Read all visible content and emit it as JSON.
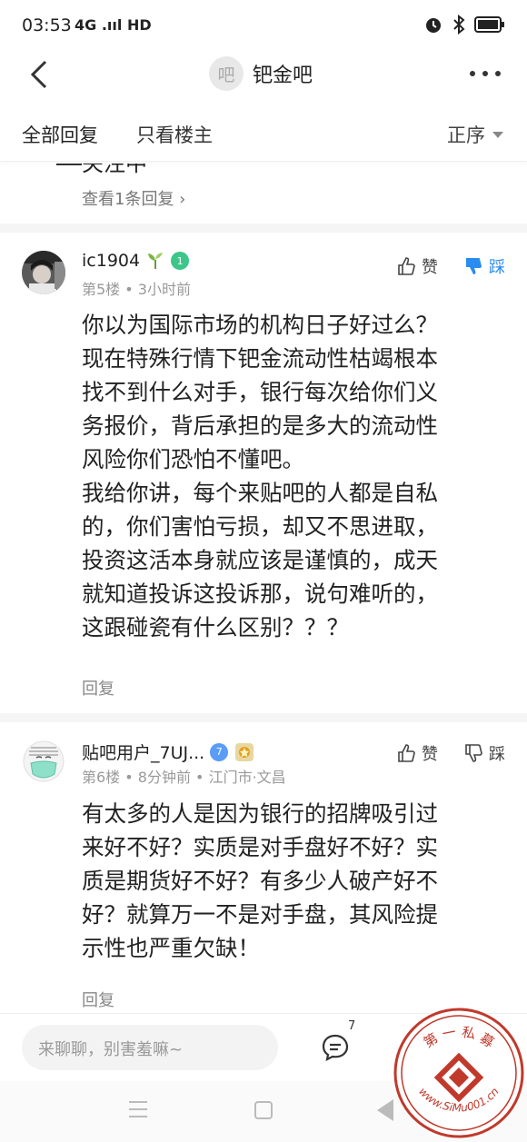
{
  "status": {
    "time": "03:53",
    "signal": "4G .ııl HD"
  },
  "nav": {
    "forum_avatar_char": "吧",
    "forum_name": "钯金吧"
  },
  "tabs": {
    "all": "全部回复",
    "owner_only": "只看楼主",
    "sort": "正序"
  },
  "partial": {
    "text": "关注中",
    "view_replies": "查看1条回复 ›"
  },
  "posts": [
    {
      "username": "ic1904",
      "level": "1",
      "meta": "第5楼 • 3小时前",
      "like_label": "赞",
      "dislike_label": "踩",
      "lines": [
        "你以为国际市场的机构日子好过么？",
        "现在特殊行情下钯金流动性枯竭根本",
        "找不到什么对手，银行每次给你们义",
        "务报价，背后承担的是多大的流动性",
        "风险你们恐怕不懂吧。",
        "我给你讲，每个来贴吧的人都是自私",
        "的，你们害怕亏损，却又不思进取，",
        "投资这活本身就应该是谨慎的，成天",
        "就知道投诉这投诉那，说句难听的，",
        "这跟碰瓷有什么区别？？？"
      ],
      "reply_label": "回复"
    },
    {
      "username": "贴吧用户_7UJ...",
      "level": "7",
      "meta": "第6楼 • 8分钟前 • 江门市·文昌",
      "like_label": "赞",
      "dislike_label": "踩",
      "lines": [
        "有太多的人是因为银行的招牌吸引过",
        "来好不好？实质是对手盘好不好？实",
        "质是期货好不好？有多少人破产好不",
        "好？就算万一不是对手盘，其风险提",
        "示性也严重欠缺！"
      ],
      "reply_label": "回复"
    }
  ],
  "bottom": {
    "input_placeholder": "来聊聊，别害羞嘛~",
    "comment_count": "7"
  },
  "watermark": {
    "text": "第 一 私 募",
    "url": "www.SiMu001.cn"
  },
  "colors": {
    "dislike_active": "#2a8cf0",
    "level_badge_green": "#3cc68a",
    "level_badge_blue": "#5a9cf8"
  }
}
